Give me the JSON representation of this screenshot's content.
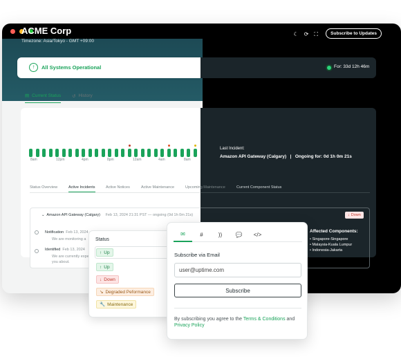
{
  "window": {
    "controls": [
      {
        "name": "close",
        "color": "#ff5f57"
      },
      {
        "name": "minimize",
        "color": "#febc2e"
      },
      {
        "name": "maximize",
        "color": "#28c840"
      }
    ]
  },
  "header": {
    "brand": "ACME Corp",
    "timezone": "Timezone: Asia/Tokyo - GMT  +09:00",
    "icons": [
      "moon-icon",
      "refresh-icon",
      "expand-icon"
    ],
    "subscribe_label": "Subscribe to Updates"
  },
  "banner": {
    "status_text": "All Systems Operational",
    "uptime_text": "For: 33d 12h 46m"
  },
  "tabs": [
    {
      "label": "Current Status",
      "icon": "calendar-icon"
    },
    {
      "label": "History",
      "icon": "history-icon"
    }
  ],
  "uptime_bars": {
    "bars": [
      {
        "state": "up"
      },
      {
        "state": "up"
      },
      {
        "state": "up"
      },
      {
        "state": "up"
      },
      {
        "state": "up"
      },
      {
        "state": "up"
      },
      {
        "state": "up"
      },
      {
        "state": "up"
      },
      {
        "state": "up"
      },
      {
        "state": "up"
      },
      {
        "state": "up"
      },
      {
        "state": "up"
      },
      {
        "state": "up"
      },
      {
        "state": "up"
      },
      {
        "state": "up"
      },
      {
        "state": "up",
        "marker": "#c0392b"
      },
      {
        "state": "up"
      },
      {
        "state": "up"
      },
      {
        "state": "up"
      },
      {
        "state": "up"
      },
      {
        "state": "up"
      },
      {
        "state": "up",
        "marker": "#e0522a"
      },
      {
        "state": "up"
      },
      {
        "state": "up"
      },
      {
        "state": "up"
      },
      {
        "state": "up",
        "marker": "#e0b400"
      }
    ],
    "tick_labels": [
      "8am",
      "12pm",
      "4pm",
      "8pm",
      "12am",
      "4am",
      "8am"
    ],
    "colors": {
      "up": "#1aa35a"
    }
  },
  "last_incident": {
    "label": "Last Incident:",
    "name": "Amazon API Gateway (Calgary)",
    "separator": "|",
    "ongoing": "Ongoing for: 0d 1h 0m 21s"
  },
  "subtabs": [
    "Status Overview",
    "Active Incidents",
    "Active Notices",
    "Active Maintenance",
    "Upcoming Maintenance",
    "Current Component Status"
  ],
  "incident": {
    "title": "Amazon API Gateway (Calgary)",
    "meta": "Feb 13, 2024 21:31 PST — ongoing (0d 1h 0m 21s)",
    "badge": "Down",
    "timeline": [
      {
        "label": "Notification",
        "time": "Feb 13, 2024",
        "text": "We are monitoring a"
      },
      {
        "label": "Identified",
        "time": "Feb 13, 2024",
        "text": "We are currently expe"
      },
      {
        "label": "",
        "time": "",
        "text": "you about."
      }
    ],
    "affected_title": "Affected Components:",
    "affected": [
      "Singapore-Singapore",
      "Malaysia-Kuala Lumpur",
      "Indonesia-Jakarta"
    ]
  },
  "status_popup": {
    "title": "Status",
    "selected": "Up",
    "options": [
      "Up",
      "Down",
      "Degraded Peformance",
      "Maintenance"
    ]
  },
  "subscribe_popup": {
    "tab_icons": [
      "email-icon",
      "slack-icon",
      "rss-icon",
      "chat-icon",
      "code-icon"
    ],
    "label": "Subscribe via Email",
    "placeholder": "user@uptime.com",
    "button": "Subscribe",
    "terms_prefix": "By subscribing you agree to the ",
    "terms_link": "Terms & Conditions",
    "terms_mid": " and ",
    "privacy_link": "Privacy Policy"
  }
}
